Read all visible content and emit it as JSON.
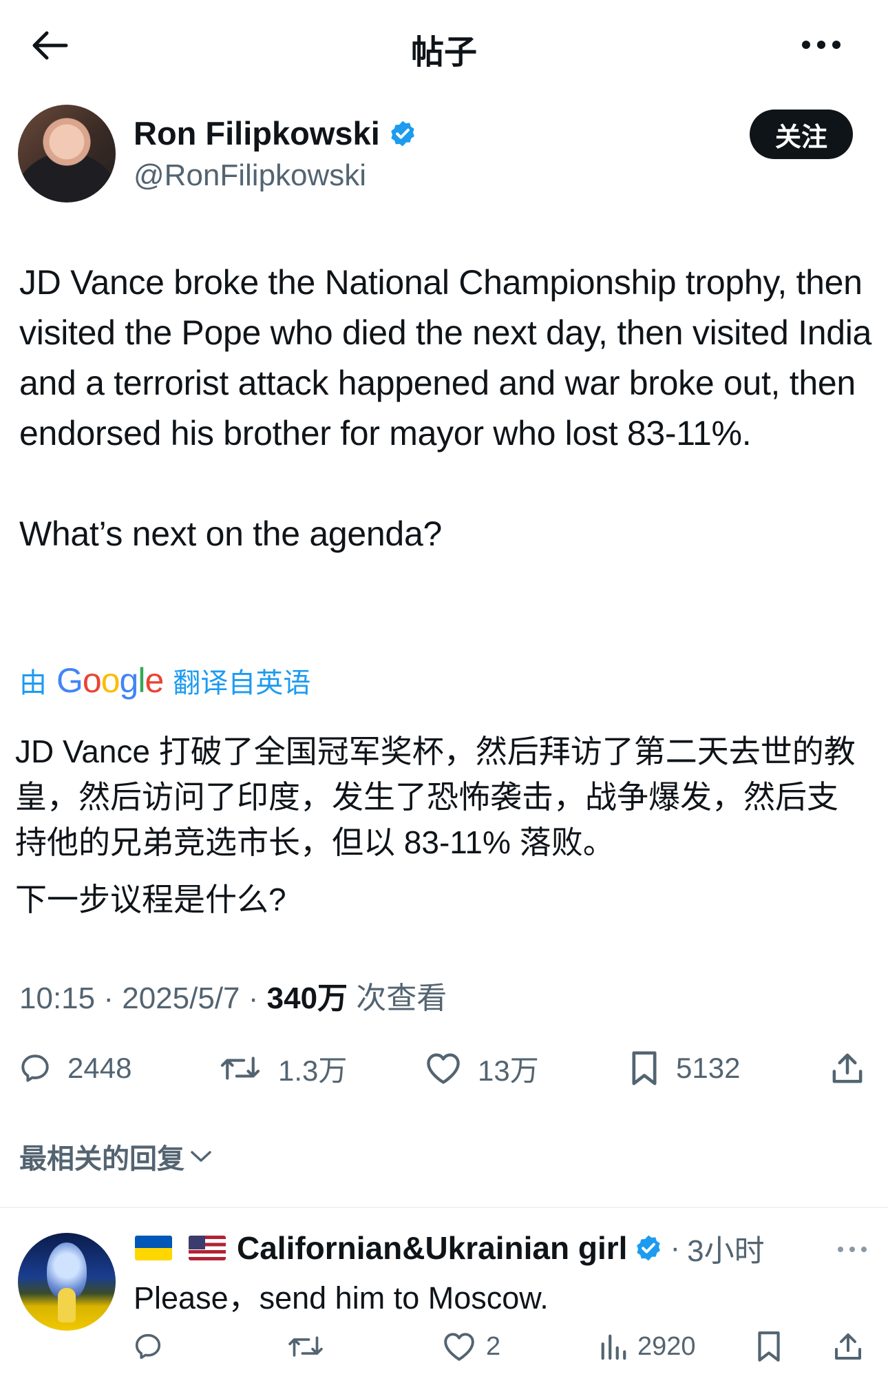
{
  "header": {
    "title": "帖子",
    "back_icon": "arrow-left-icon",
    "more_icon": "more-horizontal-icon"
  },
  "author": {
    "name": "Ron Filipkowski",
    "handle": "@RonFilipkowski",
    "verified": true,
    "follow_label": "关注"
  },
  "tweet": {
    "paragraphs": [
      "JD Vance broke the National Championship trophy, then visited the Pope who died the next day, then visited India and a terrorist attack happened and war broke out, then endorsed his brother for mayor who lost 83-11%.",
      "What’s next on the agenda?"
    ],
    "translation": {
      "prefix": "由",
      "provider": "Google",
      "suffix": "翻译自英语",
      "paragraphs": [
        "JD Vance 打破了全国冠军奖杯，然后拜访了第二天去世的教皇，然后访问了印度，发生了恐怖袭击，战争爆发，然后支持他的兄弟竞选市长，但以 83-11% 落败。",
        "下一步议程是什么?"
      ]
    },
    "time": "10:15",
    "date": "2025/5/7",
    "views_count": "340万",
    "views_label": "次查看",
    "separator": "·"
  },
  "actions": {
    "replies": "2448",
    "retweets": "1.3万",
    "likes": "13万",
    "bookmarks": "5132"
  },
  "replies_sort": {
    "label": "最相关的回复"
  },
  "reply": {
    "name": "Californian&Ukrainian girl",
    "verified": true,
    "time": "3小时",
    "text": "Please，send him to Moscow.",
    "likes": "2",
    "views": "2920"
  },
  "colors": {
    "text": "#0f1419",
    "secondary": "#536471",
    "accent": "#1d9bf0",
    "button_bg": "#0f1419"
  }
}
